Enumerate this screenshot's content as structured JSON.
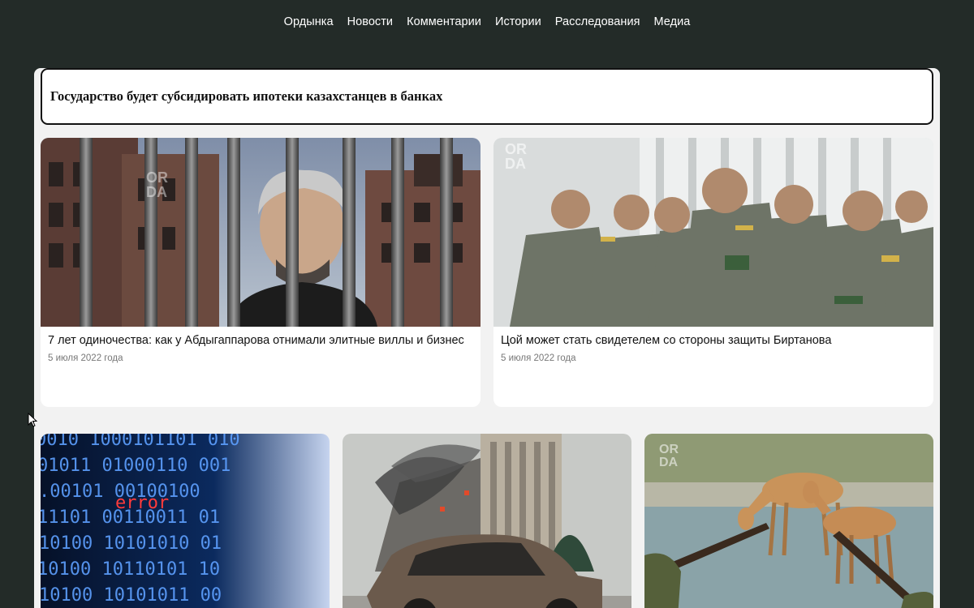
{
  "nav": {
    "items": [
      {
        "label": "Ордынка"
      },
      {
        "label": "Новости"
      },
      {
        "label": "Комментарии"
      },
      {
        "label": "Истории"
      },
      {
        "label": "Расследования"
      },
      {
        "label": "Медиа"
      }
    ]
  },
  "headline": {
    "text": "Государство будет субсидировать ипотеки казахстанцев в банках"
  },
  "cards": [
    {
      "title": "7 лет одиночества: как у Абдыгаппарова отнимали элитные виллы и бизнес",
      "date": "5 июля 2022 года",
      "image": "man-behind-bars-photo"
    },
    {
      "title": "Цой может стать свидетелем со стороны защиты Биртанова",
      "date": "5 июля 2022 года",
      "image": "officers-applauding-photo"
    },
    {
      "title": "",
      "date": "",
      "image": "binary-code-error-photo"
    },
    {
      "title": "",
      "date": "",
      "image": "burned-car-building-photo"
    },
    {
      "title": "",
      "date": "",
      "image": "saiga-hunters-photo"
    }
  ],
  "watermark": "OR DA",
  "colors": {
    "page_bg": "#232b28",
    "panel_bg": "#f2f2f2",
    "card_bg": "#ffffff",
    "nav_text": "#ffffff",
    "date_text": "#777777"
  }
}
